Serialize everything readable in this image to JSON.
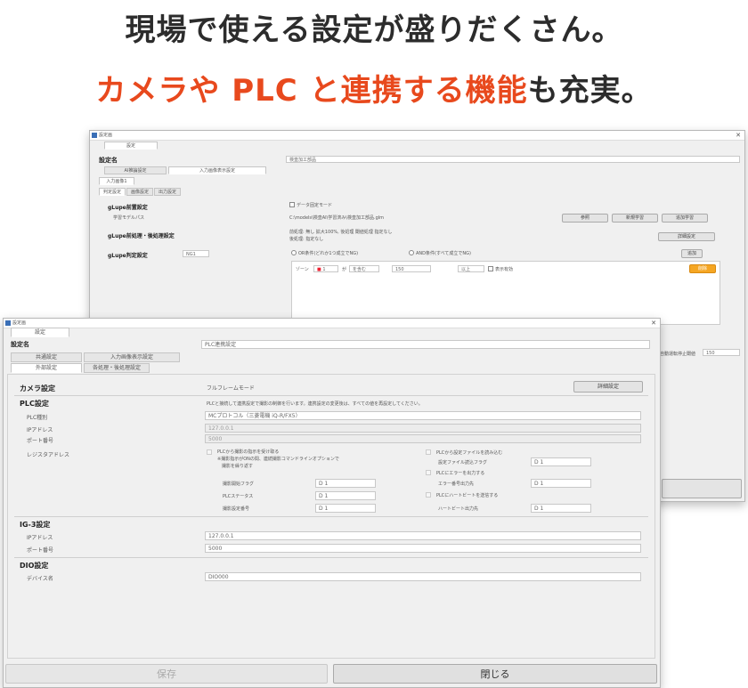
{
  "headline": {
    "line1": "現場で使える設定が盛りだくさん。",
    "line2_red": "カメラや PLC と連携する機能",
    "line2_dark": "も充実。"
  },
  "back_window": {
    "title": "設定画",
    "top_tab": "設定",
    "name_label": "設定名",
    "name_value": "検査加工部品",
    "tabs": [
      "AI推論設定",
      "入力画像表示設定"
    ],
    "subtab": "入力画像1",
    "subtabs": [
      "判定設定",
      "画像設定",
      "出力設定"
    ],
    "gluupe_label": "gLupe前置設定",
    "model_label": "学習モデルパス",
    "datastrip_label": "データ固定モード",
    "model_path": "C:\\models\\検査AI\\学習済み\\検査加工部品.glm",
    "btn_ref": "参照",
    "btn_new": "新規学習",
    "btn_add": "追加学習",
    "post_label": "gLupe前処理・後処理設定",
    "post_line1": "前処理: 無し 拡大100%, 後処理 閾値処理 指定なし",
    "post_line2": "後処理: 指定なし",
    "post_btn": "詳細設定",
    "judge_label": "gLupe判定設定",
    "judge_select": "NG1",
    "radio1": "OR条件(どれか1つ成立でNG)",
    "radio2": "AND条件(すべて成立でNG)",
    "judge_btn": "追加",
    "cond_row": {
      "label": "ゾーン",
      "value1": "1",
      "op": "を含む",
      "thr_label": "が",
      "thr": "150",
      "unit": "以上",
      "check": "表示有効",
      "del": "削除"
    },
    "side_label": "自動運転停止閾値",
    "side_value": "150"
  },
  "front_window": {
    "title": "設定画",
    "top_tab": "設定",
    "name_label": "設定名",
    "name_value": "PLC連携設定",
    "tabs": [
      "共通設定",
      "入力画像表示設定"
    ],
    "subtabs": [
      "外部設定",
      "各処理・後処理設定"
    ],
    "camera": {
      "label": "カメラ設定",
      "mode": "フルフレームモード",
      "btn": "詳細設定"
    },
    "plc": {
      "label": "PLC設定",
      "desc": "PLCと接続して連携設定で撮影の制御を行います。連携設定の変更後は、すべての値を再設定してください。",
      "type_label": "PLC種別",
      "type_value": "MCプロトコル（三菱電機 iQ-R/FX5）",
      "ip_label": "IPアドレス",
      "ip_value": "127.0.0.1",
      "port_label": "ポート番号",
      "port_value": "5000",
      "addr_label": "レジスタアドレス",
      "chk1_l1": "PLCから撮影の指示を受け取る",
      "chk1_l2": "※撮影指示がONの間、連続撮影コマンドラインオプションで",
      "chk1_l3": "　撮影を繰り返す",
      "chk2": "PLCから設定ファイルを読み込む",
      "r1_label": "撮影開始フラグ",
      "r1_value": "D 1",
      "r2_label": "PLCステータス",
      "r2_value": "D 1",
      "r3_label": "撮影設定番号",
      "r3_value": "D 1",
      "rr1_label": "設定ファイル読込フラグ",
      "rr1_value": "D 1",
      "chk3": "PLCにエラーを出力する",
      "rr2_label": "エラー番号出力先",
      "rr2_value": "D 1",
      "chk4": "PLCにハートビートを送信する",
      "rr3_label": "ハートビート出力先",
      "rr3_value": "D 1"
    },
    "ig3": {
      "label": "IG-3設定",
      "ip_label": "IPアドレス",
      "ip_value": "127.0.0.1",
      "port_label": "ポート番号",
      "port_value": "5000"
    },
    "dio": {
      "label": "DIO設定",
      "dev_label": "デバイス名",
      "dev_value": "DIO000"
    },
    "btn_save": "保存",
    "btn_close": "閉じる"
  },
  "colors": {
    "accent_red": "#e8491d",
    "orange_btn": "#f5a623"
  }
}
